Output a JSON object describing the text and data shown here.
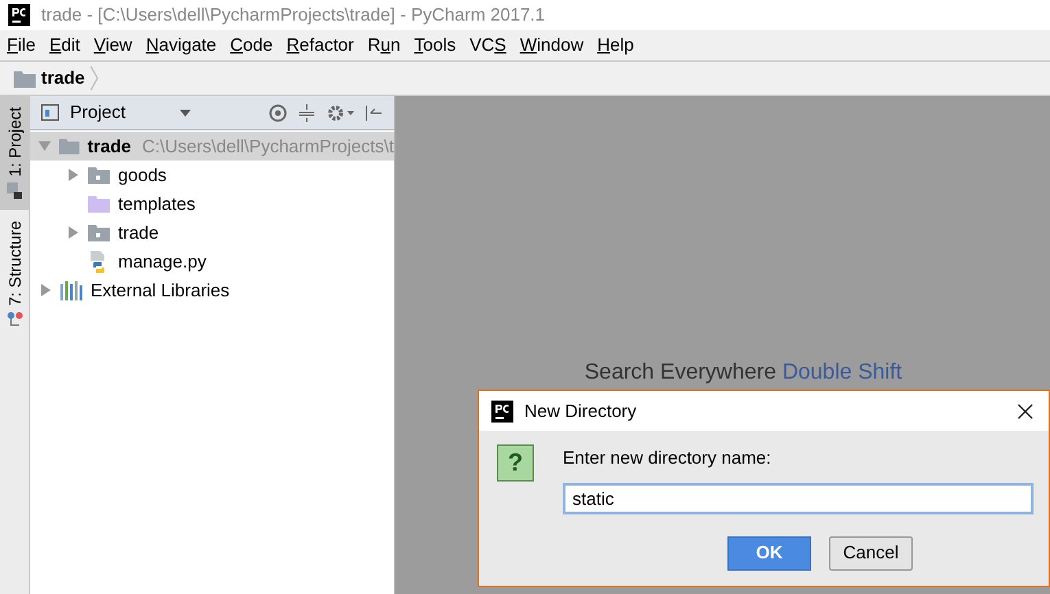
{
  "window": {
    "title": "trade - [C:\\Users\\dell\\PycharmProjects\\trade] - PyCharm 2017.1"
  },
  "menu": [
    {
      "parts": [
        {
          "text": "F",
          "underlined": true
        },
        {
          "text": "ile",
          "underlined": false
        }
      ]
    },
    {
      "parts": [
        {
          "text": "E",
          "underlined": true
        },
        {
          "text": "dit",
          "underlined": false
        }
      ]
    },
    {
      "parts": [
        {
          "text": "V",
          "underlined": true
        },
        {
          "text": "iew",
          "underlined": false
        }
      ]
    },
    {
      "parts": [
        {
          "text": "N",
          "underlined": true
        },
        {
          "text": "avigate",
          "underlined": false
        }
      ]
    },
    {
      "parts": [
        {
          "text": "C",
          "underlined": true
        },
        {
          "text": "ode",
          "underlined": false
        }
      ]
    },
    {
      "parts": [
        {
          "text": "R",
          "underlined": true
        },
        {
          "text": "efactor",
          "underlined": false
        }
      ]
    },
    {
      "parts": [
        {
          "text": "R",
          "underlined": false
        },
        {
          "text": "u",
          "underlined": true
        },
        {
          "text": "n",
          "underlined": false
        }
      ]
    },
    {
      "parts": [
        {
          "text": "T",
          "underlined": true
        },
        {
          "text": "ools",
          "underlined": false
        }
      ]
    },
    {
      "parts": [
        {
          "text": "VC",
          "underlined": false
        },
        {
          "text": "S",
          "underlined": true
        }
      ]
    },
    {
      "parts": [
        {
          "text": "W",
          "underlined": true
        },
        {
          "text": "indow",
          "underlined": false
        }
      ]
    },
    {
      "parts": [
        {
          "text": "H",
          "underlined": true
        },
        {
          "text": "elp",
          "underlined": false
        }
      ]
    }
  ],
  "breadcrumb": {
    "label": "trade"
  },
  "side_tabs": [
    {
      "label": "1: Project",
      "selected": true,
      "kind": "project"
    },
    {
      "label": "7: Structure",
      "selected": false,
      "kind": "structure"
    }
  ],
  "project_panel": {
    "view": "Project",
    "tree": [
      {
        "name": "trade",
        "path": "C:\\Users\\dell\\PycharmProjects\\t",
        "kind": "root",
        "expanded": true,
        "selected": true,
        "children": [
          {
            "name": "goods",
            "kind": "package",
            "expanded": false,
            "selected": false
          },
          {
            "name": "templates",
            "kind": "templates",
            "selected": false
          },
          {
            "name": "trade",
            "kind": "package",
            "expanded": false,
            "selected": false
          },
          {
            "name": "manage.py",
            "kind": "python",
            "selected": false
          }
        ]
      },
      {
        "name": "External Libraries",
        "kind": "libraries",
        "expanded": false,
        "selected": false
      }
    ]
  },
  "editor_hints": [
    {
      "text": "Search Everywhere ",
      "shortcut": "Double Shift"
    }
  ],
  "dialog": {
    "title": "New Directory",
    "icon_text": "?",
    "prompt": "Enter new directory name:",
    "value": "static",
    "buttons": [
      {
        "label": "OK",
        "kind": "primary"
      },
      {
        "label": "Cancel",
        "kind": "secondary"
      }
    ]
  }
}
